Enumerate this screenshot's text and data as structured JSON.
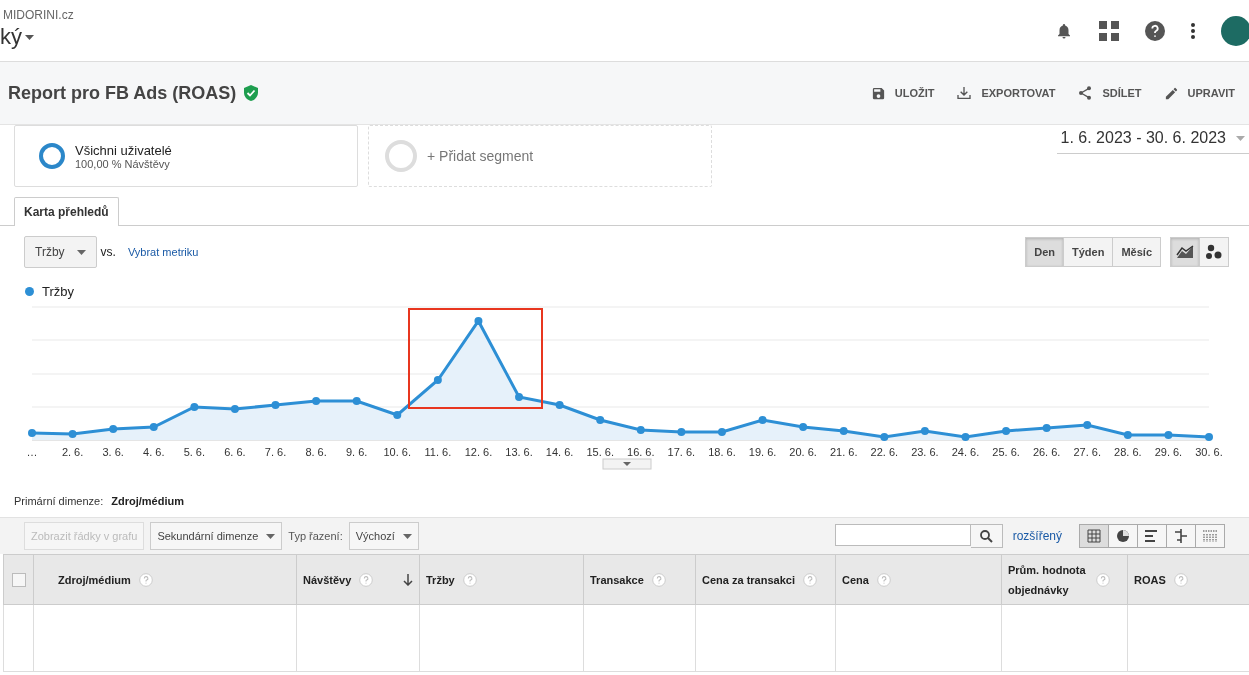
{
  "account": {
    "property": "MIDORINI.cz",
    "view": "ký"
  },
  "report": {
    "title": "Report pro FB Ads (ROAS)",
    "verified": true,
    "actions": [
      {
        "kind": "save",
        "label": "ULOŽIT"
      },
      {
        "kind": "export",
        "label": "EXPORTOVAT"
      },
      {
        "kind": "share",
        "label": "SDÍLET"
      },
      {
        "kind": "edit",
        "label": "UPRAVIT"
      }
    ]
  },
  "segments": [
    {
      "kind": "segment",
      "name": "Všichni uživatelé",
      "detail": "100,00 % Návštěvy"
    },
    {
      "kind": "add",
      "name": "+ Přidat segment"
    }
  ],
  "date_range": "1. 6. 2023 - 30. 6. 2023",
  "tabs": [
    {
      "label": "Karta přehledů",
      "selected": true
    }
  ],
  "metric": {
    "primary": "Tržby",
    "vs": "vs.",
    "select": "Vybrat metriku"
  },
  "granularity": [
    {
      "label": "Den",
      "selected": true
    },
    {
      "label": "Týden",
      "selected": false
    },
    {
      "label": "Měsíc",
      "selected": false
    }
  ],
  "chart_types": [
    {
      "kind": "line",
      "selected": true
    },
    {
      "kind": "motion",
      "selected": false
    }
  ],
  "legend": "Tržby",
  "x_labels": [
    "…",
    "2. 6.",
    "3. 6.",
    "4. 6.",
    "5. 6.",
    "6. 6.",
    "7. 6.",
    "8. 6.",
    "9. 6.",
    "10. 6.",
    "11. 6.",
    "12. 6.",
    "13. 6.",
    "14. 6.",
    "15. 6.",
    "16. 6.",
    "17. 6.",
    "18. 6.",
    "19. 6.",
    "20. 6.",
    "21. 6.",
    "22. 6.",
    "23. 6.",
    "24. 6.",
    "25. 6.",
    "26. 6.",
    "27. 6.",
    "28. 6.",
    "29. 6.",
    "30. 6."
  ],
  "primary_dimension": {
    "label": "Primární dimenze:",
    "value": "Zdroj/médium"
  },
  "toolbar": {
    "plot_rows": {
      "label": "Zobrazit řádky v grafu",
      "disabled": true
    },
    "secondary": "Sekundární dimenze",
    "sort_label": "Typ řazení:",
    "sort": "Výchozí",
    "advanced": "rozšířený",
    "views": [
      {
        "kind": "table",
        "selected": true
      },
      {
        "kind": "pie",
        "selected": false
      },
      {
        "kind": "bar",
        "selected": false
      },
      {
        "kind": "comparison",
        "selected": false
      },
      {
        "kind": "pivot",
        "selected": false
      }
    ]
  },
  "table": {
    "select_all": {
      "checked": false
    },
    "columns": [
      {
        "label": "Zdroj/médium",
        "sorted": false
      },
      {
        "label": "Návštěvy",
        "sorted": true
      },
      {
        "label": "Tržby",
        "sorted": false
      },
      {
        "label": "Transakce",
        "sorted": false
      },
      {
        "label": "Cena za transakci",
        "sorted": false
      },
      {
        "label": "Cena",
        "sorted": false
      },
      {
        "label": "Prům. hodnota objednávky",
        "sorted": false
      },
      {
        "label": "ROAS",
        "sorted": false
      }
    ]
  }
}
